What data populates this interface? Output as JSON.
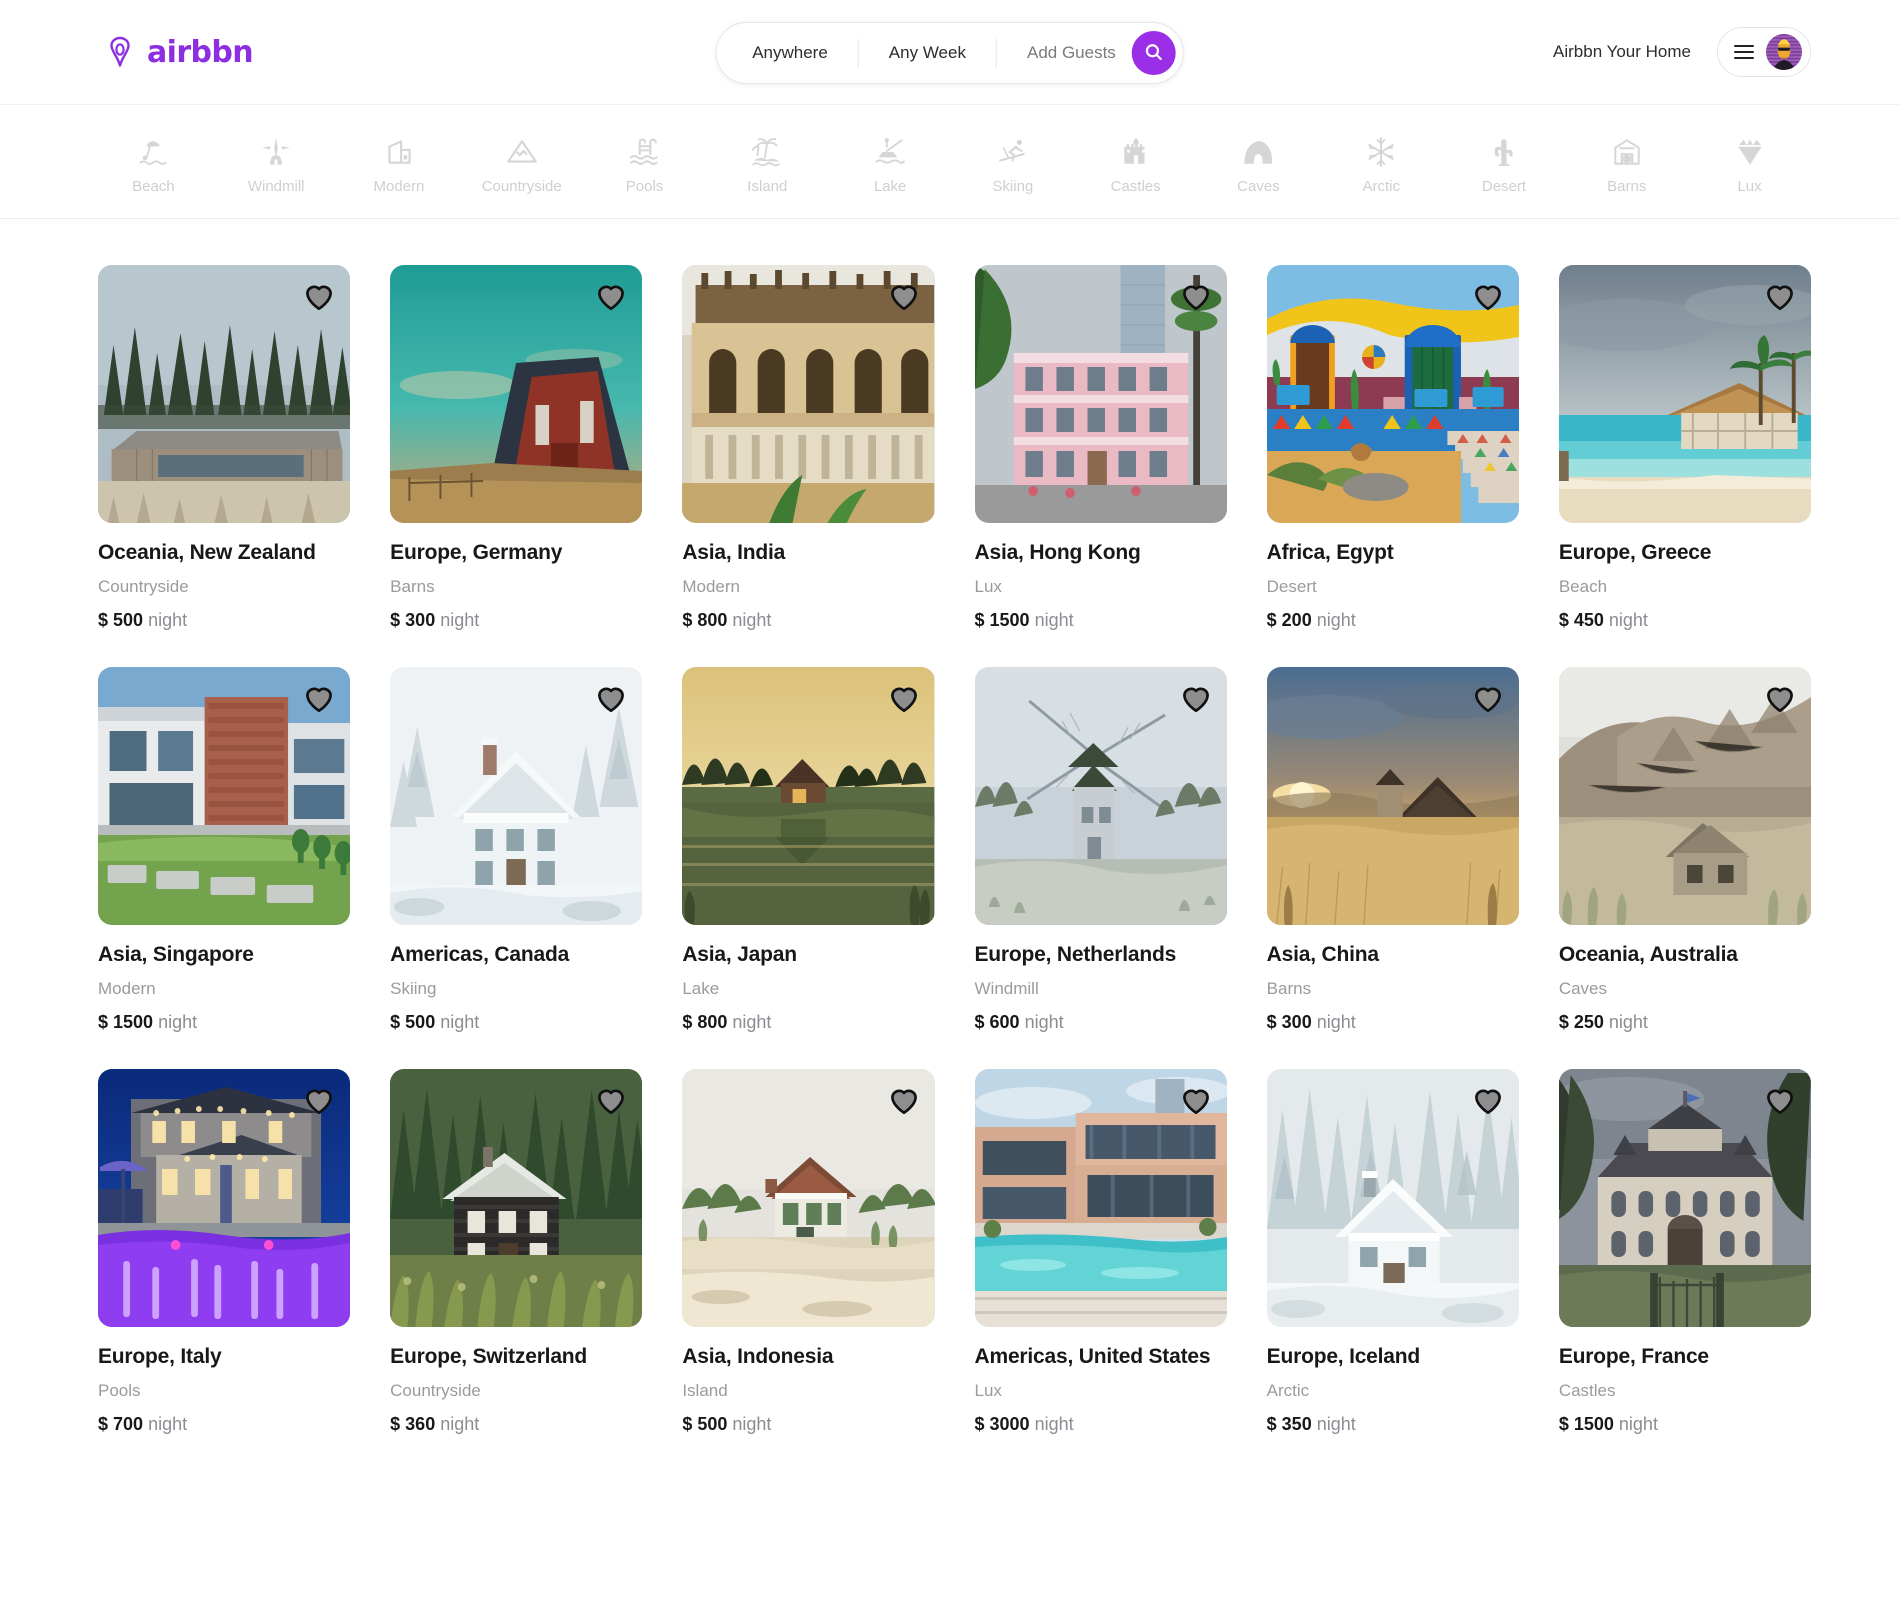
{
  "brand": {
    "name": "airbbn",
    "color": "#8B2FE0",
    "logo_icon": "airbnb-belo-icon"
  },
  "search": {
    "location": "Anywhere",
    "dates": "Any Week",
    "guests": "Add Guests",
    "search_icon": "search-icon",
    "accent": "#9B2FE8"
  },
  "header": {
    "host_link": "Airbbn Your Home",
    "menu_icon": "hamburger-menu-icon",
    "avatar_icon": "user-avatar"
  },
  "categories": [
    {
      "label": "Beach",
      "icon": "beach-umbrella-icon"
    },
    {
      "label": "Windmill",
      "icon": "windmill-icon"
    },
    {
      "label": "Modern",
      "icon": "modern-building-icon"
    },
    {
      "label": "Countryside",
      "icon": "mountain-icon"
    },
    {
      "label": "Pools",
      "icon": "pool-ladder-icon"
    },
    {
      "label": "Island",
      "icon": "palm-island-icon"
    },
    {
      "label": "Lake",
      "icon": "fishing-boat-icon"
    },
    {
      "label": "Skiing",
      "icon": "skier-icon"
    },
    {
      "label": "Castles",
      "icon": "castle-icon"
    },
    {
      "label": "Caves",
      "icon": "cave-icon"
    },
    {
      "label": "Arctic",
      "icon": "snowflake-icon"
    },
    {
      "label": "Desert",
      "icon": "cactus-icon"
    },
    {
      "label": "Barns",
      "icon": "barn-icon"
    },
    {
      "label": "Lux",
      "icon": "diamond-icon"
    }
  ],
  "listings": [
    {
      "title": "Oceania, New Zealand",
      "category": "Countryside",
      "price": "$ 500",
      "unit": "night",
      "image": "forest-timber-house"
    },
    {
      "title": "Europe, Germany",
      "category": "Barns",
      "price": "$ 300",
      "unit": "night",
      "image": "red-barn-teal-sky"
    },
    {
      "title": "Asia, India",
      "category": "Modern",
      "price": "$ 800",
      "unit": "night",
      "image": "ornate-palace-facade"
    },
    {
      "title": "Asia, Hong Kong",
      "category": "Lux",
      "price": "$ 1500",
      "unit": "night",
      "image": "pink-colonial-mansion"
    },
    {
      "title": "Africa, Egypt",
      "category": "Desert",
      "price": "$ 200",
      "unit": "night",
      "image": "nubian-painted-house"
    },
    {
      "title": "Europe, Greece",
      "category": "Beach",
      "price": "$ 450",
      "unit": "night",
      "image": "beach-thatched-hut"
    },
    {
      "title": "Asia, Singapore",
      "category": "Modern",
      "price": "$ 1500",
      "unit": "night",
      "image": "modern-brick-villa"
    },
    {
      "title": "Americas, Canada",
      "category": "Skiing",
      "price": "$ 500",
      "unit": "night",
      "image": "snow-covered-house"
    },
    {
      "title": "Asia, Japan",
      "category": "Lake",
      "price": "$ 800",
      "unit": "night",
      "image": "lakeside-cabin-sunset"
    },
    {
      "title": "Europe, Netherlands",
      "category": "Windmill",
      "price": "$ 600",
      "unit": "night",
      "image": "dutch-windmill-winter"
    },
    {
      "title": "Asia, China",
      "category": "Barns",
      "price": "$ 300",
      "unit": "night",
      "image": "golden-field-barn-sunrise"
    },
    {
      "title": "Oceania, Australia",
      "category": "Caves",
      "price": "$ 250",
      "unit": "night",
      "image": "stone-house-rocky-hill"
    },
    {
      "title": "Europe, Italy",
      "category": "Pools",
      "price": "$ 700",
      "unit": "night",
      "image": "night-villa-purple-pool"
    },
    {
      "title": "Europe, Switzerland",
      "category": "Countryside",
      "price": "$ 360",
      "unit": "night",
      "image": "dark-chalet-pines"
    },
    {
      "title": "Asia, Indonesia",
      "category": "Island",
      "price": "$ 500",
      "unit": "night",
      "image": "beachfront-cottage-sand"
    },
    {
      "title": "Americas, United States",
      "category": "Lux",
      "price": "$ 3000",
      "unit": "night",
      "image": "modern-pool-mansion"
    },
    {
      "title": "Europe, Iceland",
      "category": "Arctic",
      "price": "$ 350",
      "unit": "night",
      "image": "snow-cabin-forest"
    },
    {
      "title": "Europe, France",
      "category": "Castles",
      "price": "$ 1500",
      "unit": "night",
      "image": "french-chateau-gate"
    }
  ]
}
